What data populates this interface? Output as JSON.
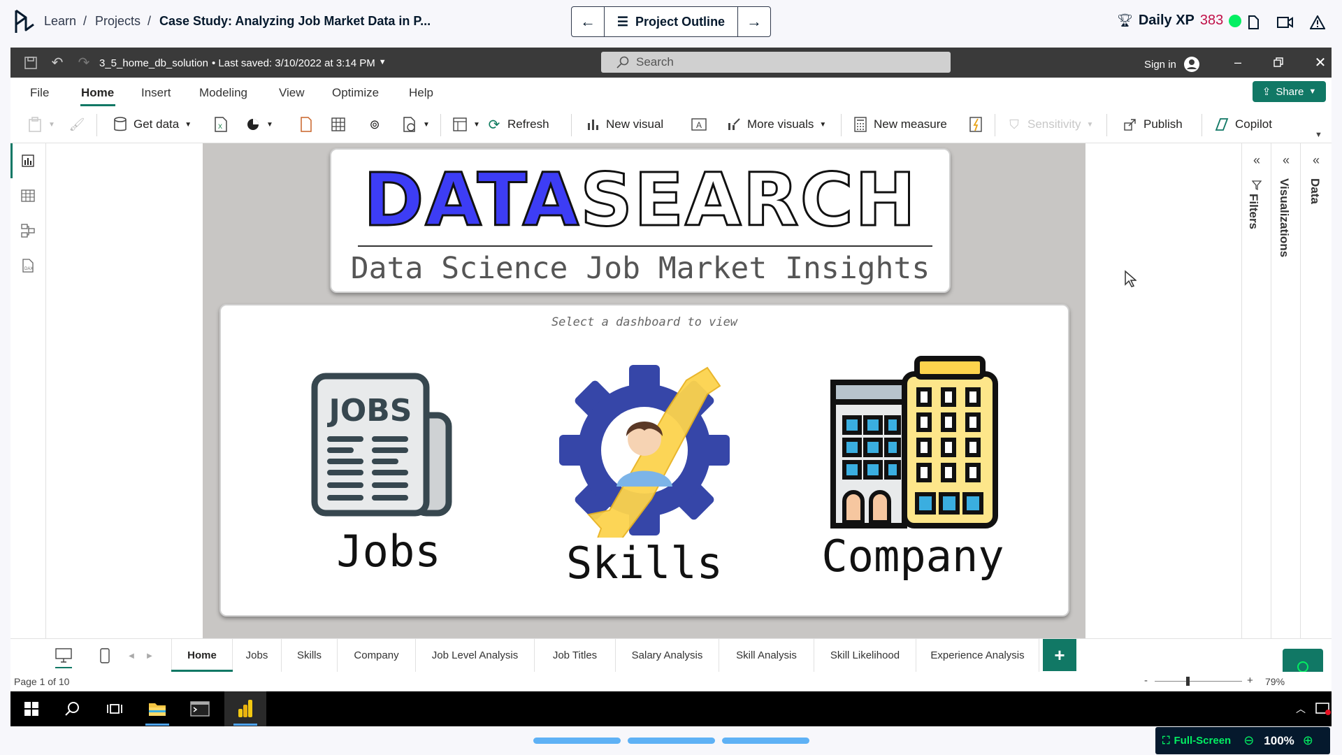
{
  "topbar": {
    "breadcrumbs": [
      "Learn",
      "Projects",
      "Case Study: Analyzing Job Market Data in P..."
    ],
    "outline_label": "Project Outline",
    "daily_xp_label": "Daily XP",
    "daily_xp_value": "383"
  },
  "titlebar": {
    "file_name": "3_5_home_db_solution",
    "saved": "• Last saved: 3/10/2022 at 3:14 PM",
    "search_placeholder": "Search",
    "sign_in": "Sign in"
  },
  "menubar": {
    "items": [
      "File",
      "Home",
      "Insert",
      "Modeling",
      "View",
      "Optimize",
      "Help"
    ],
    "active": "Home",
    "share_label": "Share"
  },
  "ribbon": {
    "get_data": "Get data",
    "refresh": "Refresh",
    "new_visual": "New visual",
    "more_visuals": "More visuals",
    "new_measure": "New measure",
    "sensitivity": "Sensitivity",
    "publish": "Publish",
    "copilot": "Copilot"
  },
  "report": {
    "logo_part1": "DATA",
    "logo_part2": "SEARCH",
    "subtitle": "Data Science Job Market Insights",
    "prompt": "Select a dashboard to view",
    "tiles": [
      {
        "label": "Jobs",
        "icon": "newspaper-jobs-icon"
      },
      {
        "label": "Skills",
        "icon": "gear-wrench-person-icon"
      },
      {
        "label": "Company",
        "icon": "office-building-icon"
      }
    ],
    "jobs_icon_text": "JOBS"
  },
  "panes": {
    "filters": "Filters",
    "visualizations": "Visualizations",
    "data": "Data"
  },
  "page_tabs": [
    "Home",
    "Jobs",
    "Skills",
    "Company",
    "Job Level Analysis",
    "Job Titles",
    "Salary Analysis",
    "Skill Analysis",
    "Skill Likelihood",
    "Experience Analysis"
  ],
  "status": {
    "page": "Page 1 of 10",
    "zoom": "79%",
    "minus": "-",
    "plus": "+"
  },
  "bottom": {
    "fullscreen": "Full-Screen",
    "zoom": "100%"
  },
  "colors": {
    "accent_green": "#117865",
    "powerbi_green": "#0f7b5f",
    "xp_red": "#c01048",
    "dc_green": "#03ef62",
    "logo_blue": "#3d3df5"
  }
}
